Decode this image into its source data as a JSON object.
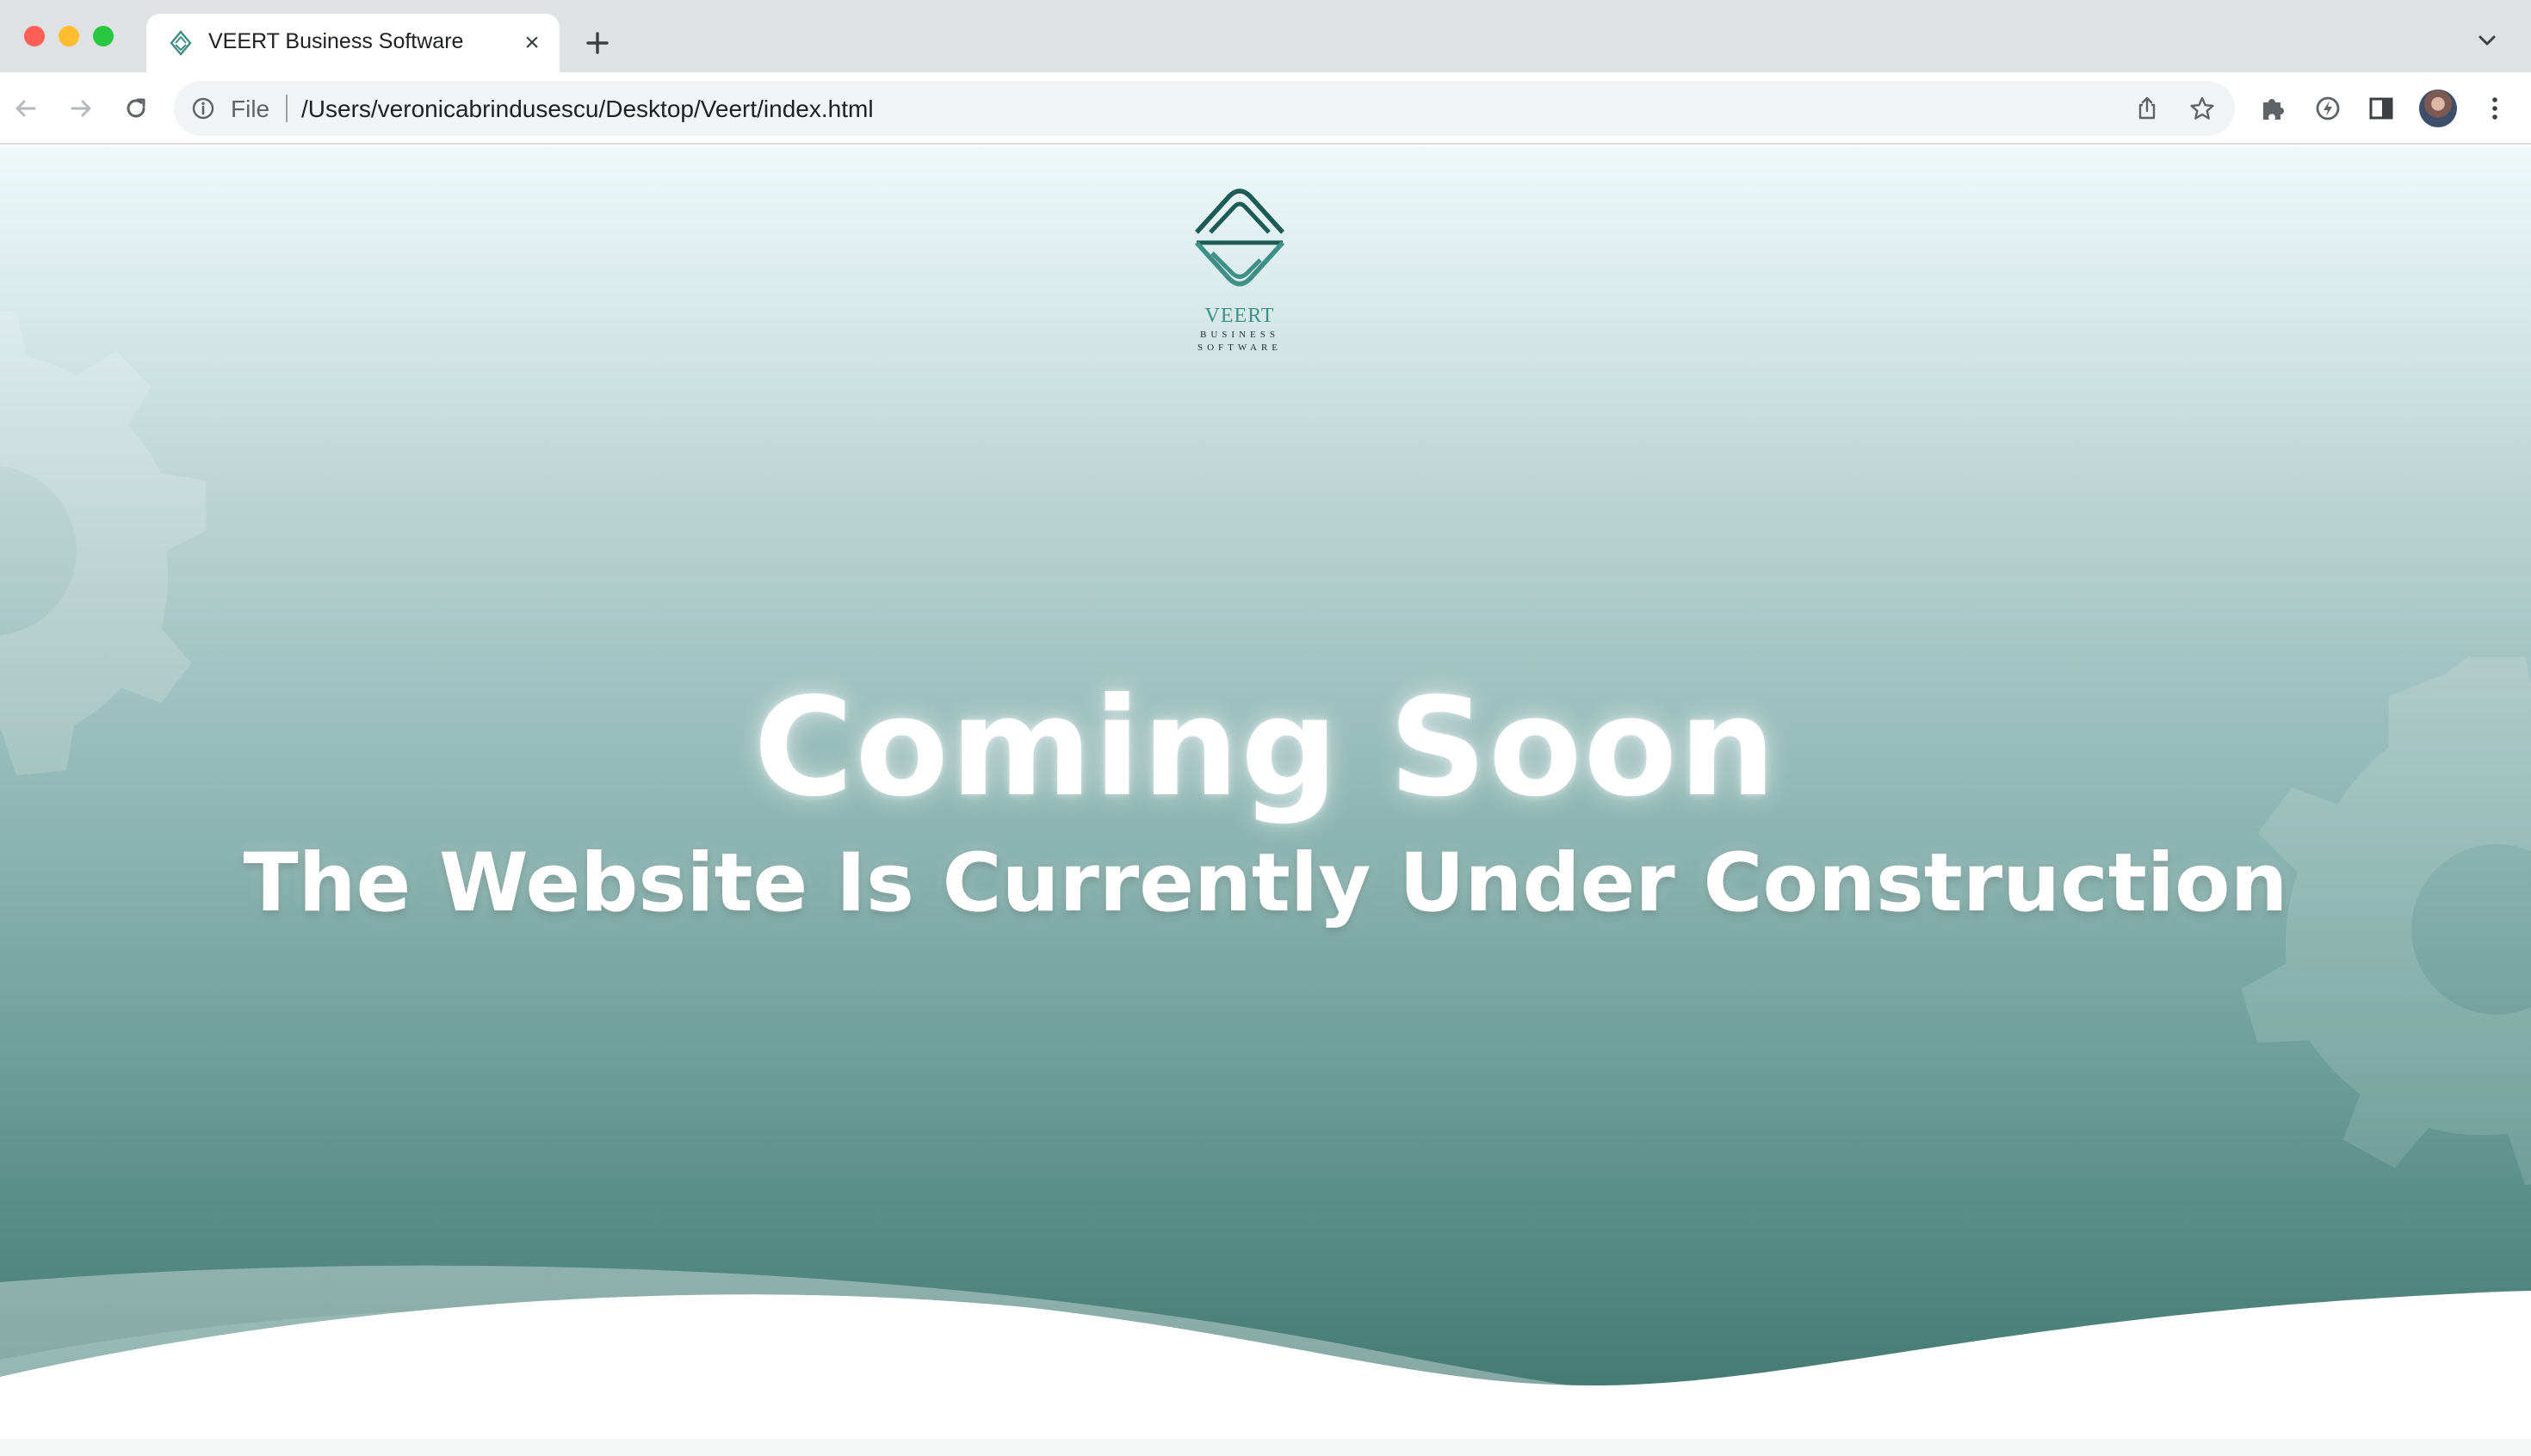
{
  "browser": {
    "tab_title": "VEERT Business Software",
    "tab_close_glyph": "×",
    "url_scheme_label": "File",
    "url": "/Users/veronicabrindusescu/Desktop/Veert/index.html",
    "icons": [
      "back-arrow-icon",
      "forward-arrow-icon",
      "reload-icon",
      "info-icon",
      "share-icon",
      "star-icon",
      "puzzle-extension-icon",
      "performance-icon",
      "side-panel-icon",
      "kebab-menu-icon",
      "plus-icon",
      "chevron-down-icon"
    ]
  },
  "page": {
    "logo": {
      "name": "VEERT",
      "line1": "BUSINESS",
      "line2": "SOFTWARE"
    },
    "headline": "Coming Soon",
    "subheadline": "The Website Is Currently Under Construction",
    "colors": {
      "brand_teal": "#3f8f87",
      "gradient_top": "#eef9fa",
      "gradient_bottom": "#3f746d",
      "text": "#ffffff"
    }
  }
}
